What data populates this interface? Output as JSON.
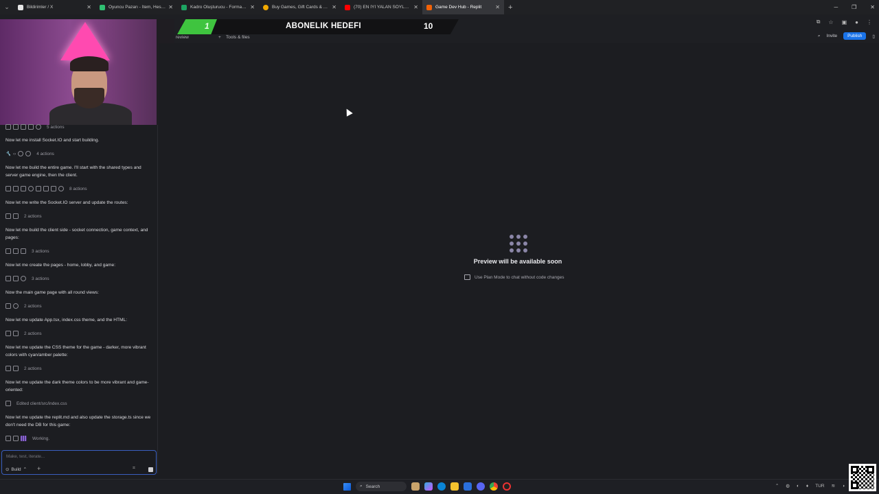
{
  "browser": {
    "tabs": [
      {
        "title": "Bildirimler / X",
        "favicon_color": "#e6e6e6",
        "icon": "x-logo-icon"
      },
      {
        "title": "Oyuncu Pazarı - İtem, Hesap, Sk",
        "favicon_color": "#2fbf71",
        "icon": "plus-logo-icon"
      },
      {
        "title": "Kadro Oluşturucu - Formasyon",
        "favicon_color": "#1da462",
        "icon": "green-square-icon"
      },
      {
        "title": "Buy Games, Gift Cards & Top Up",
        "favicon_color": "#f2a900",
        "icon": "coin-icon"
      },
      {
        "title": "(70) EN İYİ YALAN SÖYLEYEN O",
        "favicon_color": "#ff0000",
        "icon": "youtube-icon"
      },
      {
        "title": "Game Dev Hub - Replit",
        "favicon_color": "#f26207",
        "icon": "replit-icon",
        "active": true
      }
    ],
    "new_tab": "+"
  },
  "stream_overlay": {
    "current": "1",
    "label": "ABONELIK HEDEFI",
    "target": "10",
    "goal_progress": 0.1
  },
  "workspace": {
    "tab_preview": "review",
    "tab_tools": "Tools & files",
    "invite": "Invite",
    "publish": "Publish"
  },
  "chat": {
    "entries": [
      {
        "type": "actions",
        "text": "5 actions"
      },
      {
        "type": "msg",
        "text": "Now let me install Socket.IO and start building."
      },
      {
        "type": "actions",
        "text": "4 actions"
      },
      {
        "type": "msg",
        "text": "Now let me build the entire game. I'll start with the shared types and server game engine, then the client."
      },
      {
        "type": "actions",
        "text": "8 actions"
      },
      {
        "type": "msg",
        "text": "Now let me write the Socket.IO server and update the routes:"
      },
      {
        "type": "actions",
        "text": "2 actions"
      },
      {
        "type": "msg",
        "text": "Now let me build the client side - socket connection, game context, and pages:"
      },
      {
        "type": "actions",
        "text": "3 actions"
      },
      {
        "type": "msg",
        "text": "Now let me create the pages - home, lobby, and game:"
      },
      {
        "type": "actions",
        "text": "3 actions"
      },
      {
        "type": "msg",
        "text": "Now the main game page with all round views:"
      },
      {
        "type": "actions",
        "text": "2 actions"
      },
      {
        "type": "msg",
        "text": "Now let me update App.tsx, index.css theme, and the HTML:"
      },
      {
        "type": "actions",
        "text": "2 actions"
      },
      {
        "type": "msg",
        "text": "Now let me update the CSS theme for the game - darker, more vibrant colors with cyan/amber palette:"
      },
      {
        "type": "actions",
        "text": "2 actions"
      },
      {
        "type": "msg",
        "text": "Now let me update the dark theme colors to be more vibrant and game-oriented:"
      },
      {
        "type": "edited",
        "text": "Edited client/src/index.css"
      },
      {
        "type": "msg",
        "text": "Now let me update the replit.md and also update the storage.ts since we don't need the DB for this game:"
      },
      {
        "type": "working",
        "text": "Working."
      }
    ],
    "input_placeholder": "Make, test, iterate...",
    "mode": "Build"
  },
  "preview": {
    "title": "Preview will be available soon",
    "hint": "Use Plan Mode to chat without code changes"
  },
  "taskbar": {
    "search": "Search",
    "lang": "TUR"
  }
}
